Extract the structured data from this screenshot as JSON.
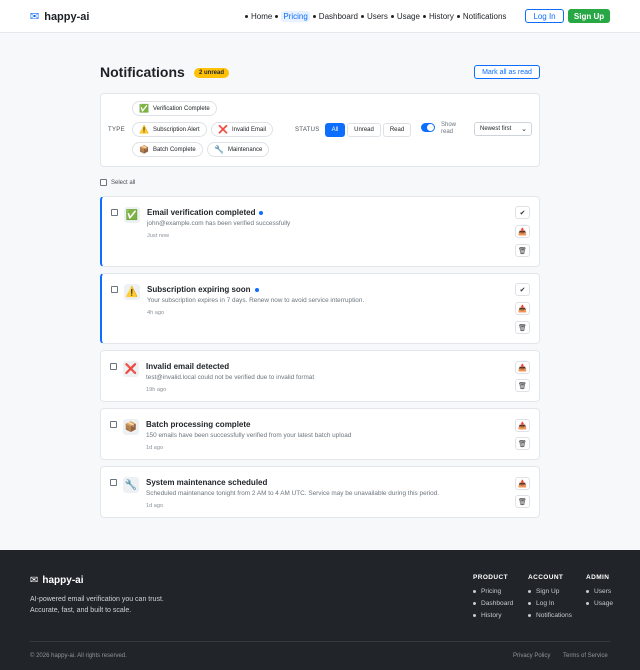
{
  "brand": {
    "name": "happy-ai",
    "icon": "envelope-icon"
  },
  "nav": {
    "links": [
      "Home",
      "Pricing",
      "Dashboard",
      "Users",
      "Usage",
      "History",
      "Notifications"
    ],
    "active": "Pricing",
    "login_label": "Log In",
    "signup_label": "Sign Up"
  },
  "header": {
    "title": "Notifications",
    "unread_badge": "2 unread",
    "mark_all_label": "Mark all as read"
  },
  "filters": {
    "type_label": "TYPE",
    "type_chips": [
      {
        "icon": "✅",
        "label": "Verification Complete"
      },
      {
        "icon": "⚠️",
        "label": "Subscription Alert"
      },
      {
        "icon": "❌",
        "label": "Invalid Email"
      },
      {
        "icon": "📦",
        "label": "Batch Complete"
      },
      {
        "icon": "🔧",
        "label": "Maintenance"
      }
    ],
    "status_label": "STATUS",
    "status_options": [
      "All",
      "Unread",
      "Read"
    ],
    "status_selected": "All",
    "show_read_label": "Show read",
    "show_read_enabled": true,
    "sort_value": "Newest first"
  },
  "select_all_label": "Select all",
  "notifications": [
    {
      "icon": "✅",
      "title": "Email verification completed",
      "message": "john@example.com has been verified successfully",
      "time": "Just now",
      "unread": true
    },
    {
      "icon": "⚠️",
      "title": "Subscription expiring soon",
      "message": "Your subscription expires in 7 days. Renew now to avoid service interruption.",
      "time": "4h ago",
      "unread": true
    },
    {
      "icon": "❌",
      "title": "Invalid email detected",
      "message": "test@invalid.local could not be verified due to invalid format",
      "time": "19h ago",
      "unread": false
    },
    {
      "icon": "📦",
      "title": "Batch processing complete",
      "message": "150 emails have been successfully verified from your latest batch upload",
      "time": "1d ago",
      "unread": false
    },
    {
      "icon": "🔧",
      "title": "System maintenance scheduled",
      "message": "Scheduled maintenance tonight from 2 AM to 4 AM UTC. Service may be unavailable during this period.",
      "time": "1d ago",
      "unread": false
    }
  ],
  "actions": {
    "mark_read": "✔",
    "archive": "📥",
    "delete": "🗑"
  },
  "footer": {
    "brand": "happy-ai",
    "tagline": "AI-powered email verification you can trust. Accurate, fast, and built to scale.",
    "columns": [
      {
        "heading": "PRODUCT",
        "links": [
          "Pricing",
          "Dashboard",
          "History"
        ]
      },
      {
        "heading": "ACCOUNT",
        "links": [
          "Sign Up",
          "Log In",
          "Notifications"
        ]
      },
      {
        "heading": "ADMIN",
        "links": [
          "Users",
          "Usage"
        ]
      }
    ],
    "copyright": "© 2026 happy-ai. All rights reserved.",
    "privacy": "Privacy Policy",
    "terms": "Terms of Service"
  },
  "colors": {
    "primary": "#0d6efd",
    "success": "#28a745",
    "warning": "#ffc107",
    "footer_bg": "#212529"
  }
}
